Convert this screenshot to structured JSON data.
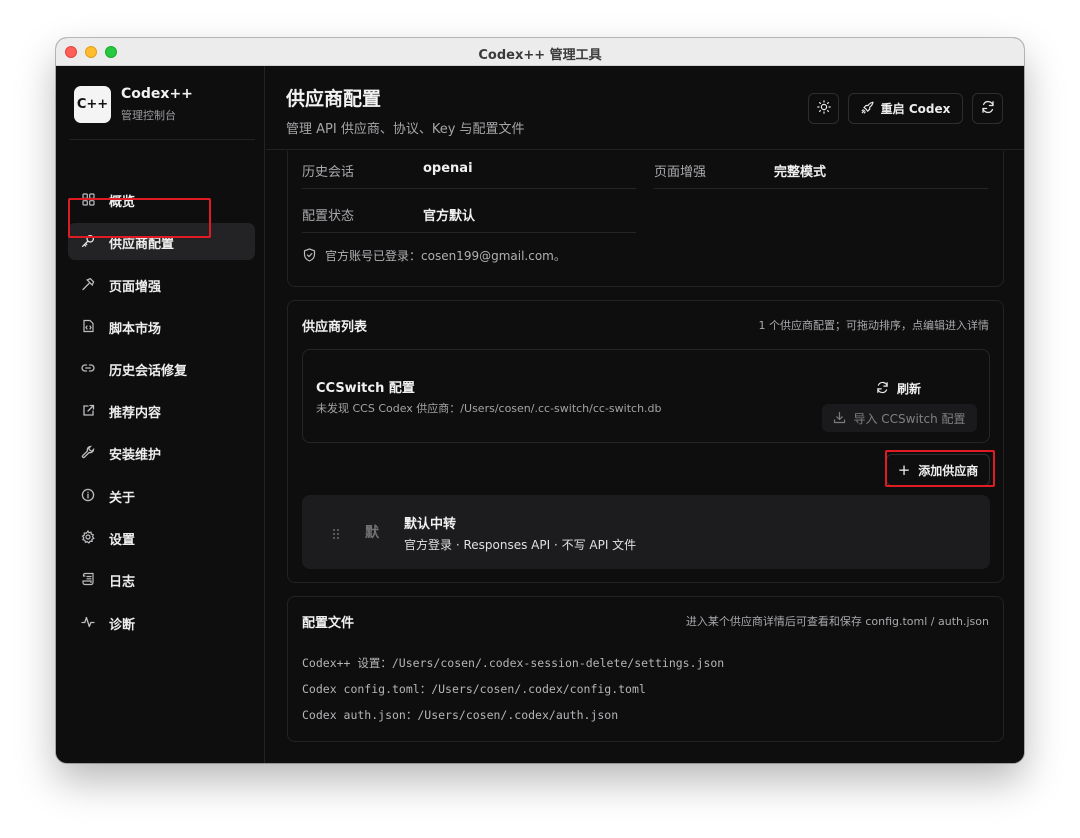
{
  "window": {
    "title": "Codex++ 管理工具"
  },
  "brand": {
    "logo": "C++",
    "name": "Codex++",
    "subtitle": "管理控制台"
  },
  "sidebar": {
    "items": [
      {
        "label": "概览",
        "icon": "grid-icon"
      },
      {
        "label": "供应商配置",
        "icon": "key-icon",
        "active": true
      },
      {
        "label": "页面增强",
        "icon": "hammer-icon"
      },
      {
        "label": "脚本市场",
        "icon": "script-icon"
      },
      {
        "label": "历史会话修复",
        "icon": "link-icon"
      },
      {
        "label": "推荐内容",
        "icon": "external-link-icon"
      },
      {
        "label": "安装维护",
        "icon": "wrench-icon"
      },
      {
        "label": "关于",
        "icon": "info-icon"
      },
      {
        "label": "设置",
        "icon": "gear-icon"
      },
      {
        "label": "日志",
        "icon": "scroll-icon"
      },
      {
        "label": "诊断",
        "icon": "activity-icon"
      }
    ]
  },
  "header": {
    "title": "供应商配置",
    "subtitle": "管理 API 供应商、协议、Key 与配置文件",
    "restart_label": "重启 Codex"
  },
  "status": {
    "history_label": "历史会话",
    "history_value": "openai",
    "enhance_label": "页面增强",
    "enhance_value": "完整模式",
    "config_label": "配置状态",
    "config_value": "官方默认",
    "account_text": "官方账号已登录：cosen199@gmail.com。"
  },
  "providers": {
    "title": "供应商列表",
    "note": "1 个供应商配置；可拖动排序，点编辑进入详情",
    "ccswitch": {
      "title": "CCSwitch 配置",
      "desc": "未发现 CCS Codex 供应商：/Users/cosen/.cc-switch/cc-switch.db",
      "refresh_label": "刷新",
      "import_label": "导入 CCSwitch 配置"
    },
    "add_label": "添加供应商",
    "items": [
      {
        "badge": "默",
        "name": "默认中转",
        "meta": "官方登录 · Responses API · 不写 API 文件"
      }
    ]
  },
  "config_files": {
    "title": "配置文件",
    "note": "进入某个供应商详情后可查看和保存 config.toml / auth.json",
    "lines": [
      "Codex++ 设置：/Users/cosen/.codex-session-delete/settings.json",
      "Codex config.toml：/Users/cosen/.codex/config.toml",
      "Codex auth.json：/Users/cosen/.codex/auth.json"
    ]
  },
  "colors": {
    "highlight": "#e01b24",
    "background": "#0e0e0f",
    "card_border": "#232325"
  }
}
